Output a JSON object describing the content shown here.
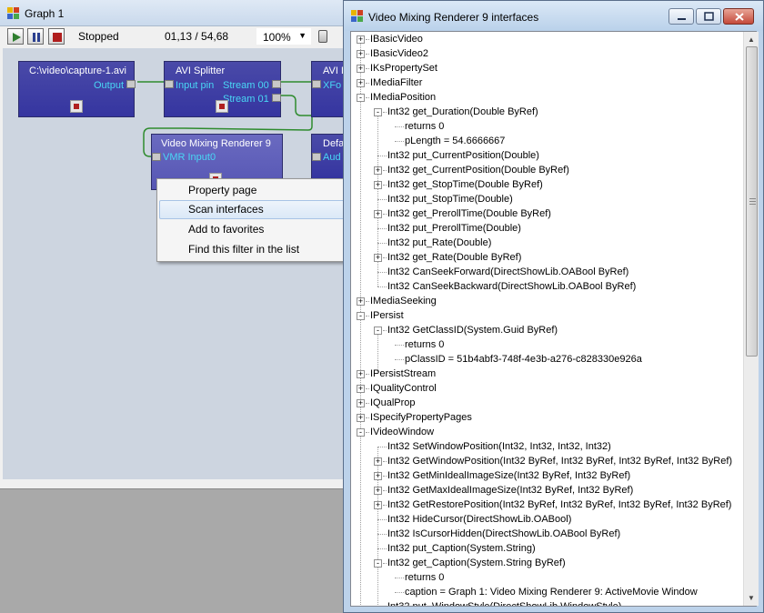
{
  "graph_window": {
    "title": "Graph 1",
    "toolbar": {
      "play_icon": "play-icon",
      "pause_icon": "pause-icon",
      "stop_icon": "stop-icon",
      "status": "Stopped",
      "position": "01,13 / 54,68",
      "zoom": "100%"
    },
    "filters": {
      "source": {
        "name": "C:\\video\\capture-1.avi",
        "pin_output": "Output"
      },
      "splitter": {
        "name": "AVI Splitter",
        "pin_input": "Input pin",
        "pin_stream0": "Stream 00",
        "pin_stream1": "Stream 01"
      },
      "decoder": {
        "name": "AVI D",
        "pin_input": "XFo"
      },
      "vmr": {
        "name": "Video Mixing Renderer 9",
        "pin_input": "VMR Input0"
      },
      "audio": {
        "name": "Defa",
        "pin_input": "Aud"
      }
    },
    "colors": {
      "filter_bg": "#3a3aa3",
      "pin_label": "#49d7f5",
      "canvas": "#cdd5e0",
      "connection": "#2e8b2e"
    }
  },
  "context_menu": {
    "items": [
      {
        "label": "Property page"
      },
      {
        "label": "Scan interfaces"
      },
      {
        "label": "Add to favorites"
      },
      {
        "label": "Find this filter in the list"
      }
    ],
    "highlighted_index": 1
  },
  "iface_window": {
    "title": "Video Mixing Renderer 9 interfaces",
    "tree": [
      {
        "level": 0,
        "exp": "+",
        "text": "IBasicVideo"
      },
      {
        "level": 0,
        "exp": "+",
        "text": "IBasicVideo2"
      },
      {
        "level": 0,
        "exp": "+",
        "text": "IKsPropertySet"
      },
      {
        "level": 0,
        "exp": "+",
        "text": "IMediaFilter"
      },
      {
        "level": 0,
        "exp": "-",
        "text": "IMediaPosition"
      },
      {
        "level": 1,
        "exp": "-",
        "text": "Int32 get_Duration(Double ByRef)"
      },
      {
        "level": 2,
        "exp": "",
        "text": "returns 0"
      },
      {
        "level": 2,
        "exp": "",
        "text": "pLength = 54.6666667"
      },
      {
        "level": 1,
        "exp": "",
        "text": "Int32 put_CurrentPosition(Double)"
      },
      {
        "level": 1,
        "exp": "+",
        "text": "Int32 get_CurrentPosition(Double ByRef)"
      },
      {
        "level": 1,
        "exp": "+",
        "text": "Int32 get_StopTime(Double ByRef)"
      },
      {
        "level": 1,
        "exp": "",
        "text": "Int32 put_StopTime(Double)"
      },
      {
        "level": 1,
        "exp": "+",
        "text": "Int32 get_PrerollTime(Double ByRef)"
      },
      {
        "level": 1,
        "exp": "",
        "text": "Int32 put_PrerollTime(Double)"
      },
      {
        "level": 1,
        "exp": "",
        "text": "Int32 put_Rate(Double)"
      },
      {
        "level": 1,
        "exp": "+",
        "text": "Int32 get_Rate(Double ByRef)"
      },
      {
        "level": 1,
        "exp": "",
        "text": "Int32 CanSeekForward(DirectShowLib.OABool ByRef)"
      },
      {
        "level": 1,
        "exp": "",
        "text": "Int32 CanSeekBackward(DirectShowLib.OABool ByRef)"
      },
      {
        "level": 0,
        "exp": "+",
        "text": "IMediaSeeking"
      },
      {
        "level": 0,
        "exp": "-",
        "text": "IPersist"
      },
      {
        "level": 1,
        "exp": "-",
        "text": "Int32 GetClassID(System.Guid ByRef)"
      },
      {
        "level": 2,
        "exp": "",
        "text": "returns 0"
      },
      {
        "level": 2,
        "exp": "",
        "text": "pClassID = 51b4abf3-748f-4e3b-a276-c828330e926a"
      },
      {
        "level": 0,
        "exp": "+",
        "text": "IPersistStream"
      },
      {
        "level": 0,
        "exp": "+",
        "text": "IQualityControl"
      },
      {
        "level": 0,
        "exp": "+",
        "text": "IQualProp"
      },
      {
        "level": 0,
        "exp": "+",
        "text": "ISpecifyPropertyPages"
      },
      {
        "level": 0,
        "exp": "-",
        "text": "IVideoWindow"
      },
      {
        "level": 1,
        "exp": "",
        "text": "Int32 SetWindowPosition(Int32, Int32, Int32, Int32)"
      },
      {
        "level": 1,
        "exp": "+",
        "text": "Int32 GetWindowPosition(Int32 ByRef, Int32 ByRef, Int32 ByRef, Int32 ByRef)"
      },
      {
        "level": 1,
        "exp": "+",
        "text": "Int32 GetMinIdealImageSize(Int32 ByRef, Int32 ByRef)"
      },
      {
        "level": 1,
        "exp": "+",
        "text": "Int32 GetMaxIdealImageSize(Int32 ByRef, Int32 ByRef)"
      },
      {
        "level": 1,
        "exp": "+",
        "text": "Int32 GetRestorePosition(Int32 ByRef, Int32 ByRef, Int32 ByRef, Int32 ByRef)"
      },
      {
        "level": 1,
        "exp": "",
        "text": "Int32 HideCursor(DirectShowLib.OABool)"
      },
      {
        "level": 1,
        "exp": "",
        "text": "Int32 IsCursorHidden(DirectShowLib.OABool ByRef)"
      },
      {
        "level": 1,
        "exp": "",
        "text": "Int32 put_Caption(System.String)"
      },
      {
        "level": 1,
        "exp": "-",
        "text": "Int32 get_Caption(System.String ByRef)"
      },
      {
        "level": 2,
        "exp": "",
        "text": "returns 0"
      },
      {
        "level": 2,
        "exp": "",
        "text": "caption = Graph 1: Video Mixing Renderer 9: ActiveMovie Window"
      },
      {
        "level": 1,
        "exp": "",
        "text": "Int32 put_WindowStyle(DirectShowLib.WindowStyle)"
      }
    ]
  }
}
